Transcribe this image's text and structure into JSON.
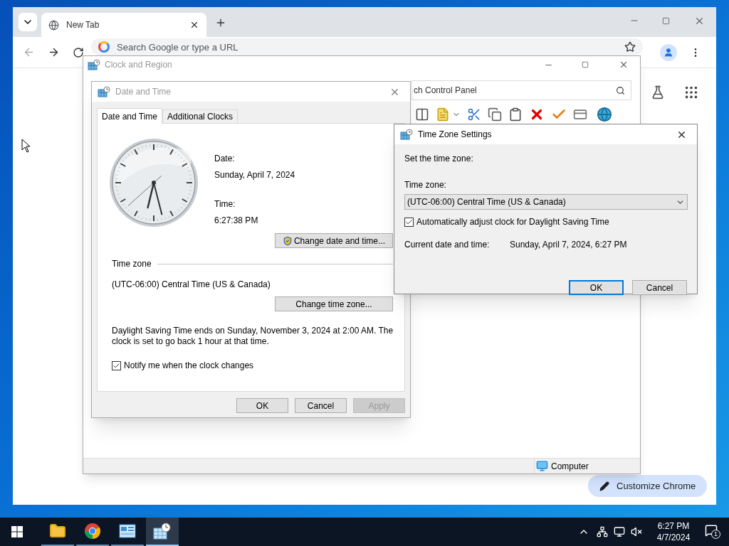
{
  "browser": {
    "tab": {
      "title": "New Tab",
      "selected": true
    },
    "address_bar": {
      "placeholder": "Search Google or type a URL"
    },
    "customize_button": "Customize Chrome"
  },
  "control_panel": {
    "title": "Clock and Region",
    "active": false,
    "search": {
      "placeholder": "ch Control Panel"
    },
    "status_bar": {
      "location": "Computer"
    }
  },
  "date_time_dialog": {
    "title": "Date and Time",
    "active": false,
    "tabs": [
      {
        "label": "Date and Time",
        "selected": true
      },
      {
        "label": "Additional Clocks",
        "selected": false
      }
    ],
    "date_label": "Date:",
    "date": "Sunday, April 7, 2024",
    "time_label": "Time:",
    "time": "6:27:38 PM",
    "change_datetime_button": "Change date and time...",
    "timezone_heading": "Time zone",
    "timezone": "(UTC-06:00) Central Time (US & Canada)",
    "change_timezone_button": "Change time zone...",
    "dst_note": "Daylight Saving Time ends on Sunday, November 3, 2024 at 2:00 AM. The clock is set to go back 1 hour at that time.",
    "notify": {
      "label": "Notify me when the clock changes",
      "checked": true
    },
    "buttons": [
      {
        "label": "OK",
        "disabled": false
      },
      {
        "label": "Cancel",
        "disabled": false
      },
      {
        "label": "Apply",
        "disabled": true
      }
    ]
  },
  "timezone_dialog": {
    "title": "Time Zone Settings",
    "active": true,
    "instruction": "Set the time zone:",
    "timezone_label": "Time zone:",
    "timezone_value": "(UTC-06:00) Central Time (US & Canada)",
    "auto_dst": {
      "label": "Automatically adjust clock for Daylight Saving Time",
      "checked": true
    },
    "current_label": "Current date and time:",
    "current_value": "Sunday, April 7, 2024, 6:27 PM",
    "buttons": [
      {
        "label": "OK",
        "default": true
      },
      {
        "label": "Cancel",
        "default": false
      }
    ]
  },
  "taskbar": {
    "apps": [
      {
        "kind": "folder",
        "selected": false
      },
      {
        "kind": "chrome",
        "selected": false
      },
      {
        "kind": "control-panel",
        "selected": false
      },
      {
        "kind": "date-time",
        "selected": true
      }
    ],
    "time": "6:27 PM",
    "date": "4/7/2024",
    "notifications": "1"
  }
}
